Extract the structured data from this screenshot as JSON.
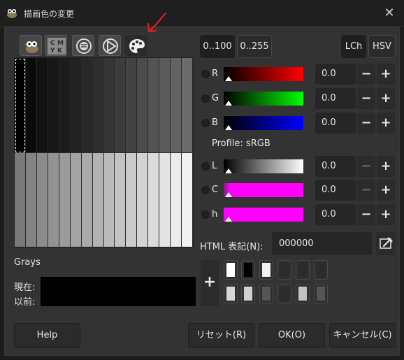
{
  "window": {
    "title": "描画色の変更",
    "close_glyph": "✕"
  },
  "selector_tabs": [
    {
      "name": "gimp-tab",
      "icon": "wilber-icon"
    },
    {
      "name": "cmyk-tab",
      "icon": "cmyk-icon",
      "letters": [
        "C",
        "M",
        "Y",
        "K"
      ]
    },
    {
      "name": "water-tab",
      "icon": "wheel-icon"
    },
    {
      "name": "triangle-tab",
      "icon": "triangle-icon"
    },
    {
      "name": "palette-tab",
      "icon": "palette-icon",
      "active": true
    }
  ],
  "palette": {
    "name": "Grays",
    "rows": [
      [
        "#000000",
        "#0b0b0b",
        "#121212",
        "#171717",
        "#1c1c1c",
        "#222222",
        "#282828",
        "#2e2e2e",
        "#353535",
        "#3c3c3c",
        "#434343",
        "#4b4b4b",
        "#535353",
        "#5b5b5b",
        "#636363",
        "#6b6b6b"
      ],
      [
        "#7a7a7a",
        "#838383",
        "#8b8b8b",
        "#939393",
        "#9b9b9b",
        "#a3a3a3",
        "#ababab",
        "#b3b3b3",
        "#bbbbbb",
        "#c3c3c3",
        "#cbcbcb",
        "#d3d3d3",
        "#dbdbdb",
        "#e3e3e3",
        "#ebebeb",
        "#f3f3f3"
      ]
    ]
  },
  "current": {
    "label": "現在:",
    "color": "#000000"
  },
  "previous": {
    "label": "以前:",
    "color": "#000000"
  },
  "range_buttons": {
    "range_100": "0..100",
    "range_255": "0..255"
  },
  "model_buttons": {
    "lch": "LCh",
    "hsv": "HSV"
  },
  "channels": [
    {
      "id": "r",
      "label": "R",
      "value": "0.0",
      "minus_enabled": true
    },
    {
      "id": "g",
      "label": "G",
      "value": "0.0",
      "minus_enabled": true
    },
    {
      "id": "b",
      "label": "B",
      "value": "0.0",
      "minus_enabled": true
    },
    {
      "id": "l",
      "label": "L",
      "value": "0.0",
      "minus_enabled": false
    },
    {
      "id": "c",
      "label": "C",
      "value": "0.0",
      "minus_enabled": false
    },
    {
      "id": "h",
      "label": "h",
      "value": "0.0",
      "minus_enabled": true
    }
  ],
  "profile": "Profile: sRGB",
  "html_notation": {
    "label": "HTML 表記(N):",
    "value": "000000"
  },
  "history": {
    "add_glyph": "+",
    "colors": [
      [
        "#ffffff",
        "#000000",
        "#f2f2f2",
        "#2b2b2b",
        "#2b2b2b",
        "#2b2b2b"
      ],
      [
        "#d6d6d6",
        "#cfcfcf",
        "#555555",
        "#2b2b2b",
        "#c2c2c2",
        "#555555"
      ]
    ]
  },
  "footer": {
    "help": "Help",
    "reset": "リセット(R)",
    "ok": "OK(O)",
    "cancel": "キャンセル(C)"
  },
  "colors": {
    "accent_red": "#ff0000",
    "accent_green": "#00ff00",
    "accent_blue": "#0000ff",
    "magenta": "#ff00ff",
    "annotation": "#e02020"
  }
}
